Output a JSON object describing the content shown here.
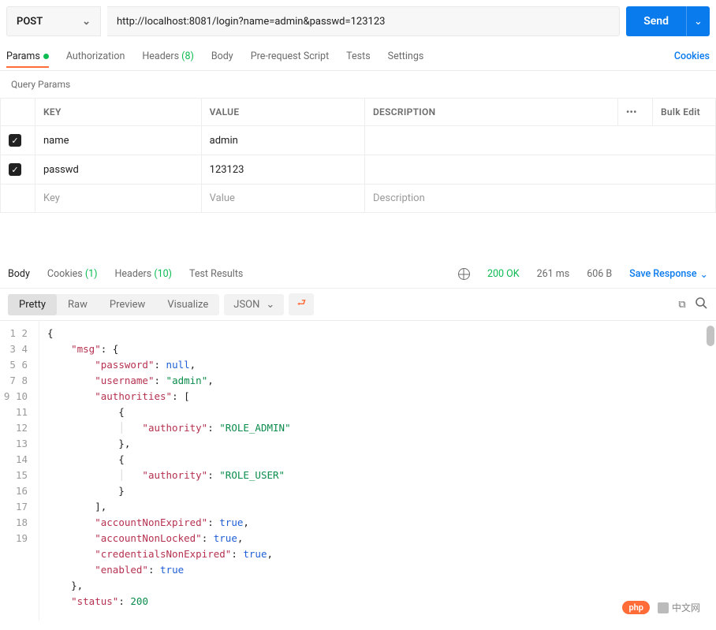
{
  "request": {
    "method": "POST",
    "url": "http://localhost:8081/login?name=admin&passwd=123123",
    "send_label": "Send"
  },
  "request_tabs": {
    "params": "Params",
    "authorization": "Authorization",
    "headers_prefix": "Headers ",
    "headers_count": "(8)",
    "body": "Body",
    "prerequest": "Pre-request Script",
    "tests": "Tests",
    "settings": "Settings",
    "cookies": "Cookies"
  },
  "query_params": {
    "title": "Query Params",
    "headers": {
      "key": "KEY",
      "value": "VALUE",
      "description": "DESCRIPTION"
    },
    "rows": [
      {
        "checked": true,
        "key": "name",
        "value": "admin",
        "description": ""
      },
      {
        "checked": true,
        "key": "passwd",
        "value": "123123",
        "description": ""
      }
    ],
    "placeholder_key": "Key",
    "placeholder_value": "Value",
    "placeholder_description": "Description",
    "bulk_edit": "Bulk Edit"
  },
  "response_tabs": {
    "body": "Body",
    "cookies_prefix": "Cookies ",
    "cookies_count": "(1)",
    "headers_prefix": "Headers ",
    "headers_count": "(10)",
    "test_results": "Test Results",
    "status": "200 OK",
    "time": "261 ms",
    "size": "606 B",
    "save_response": "Save Response"
  },
  "viewbar": {
    "pretty": "Pretty",
    "raw": "Raw",
    "preview": "Preview",
    "visualize": "Visualize",
    "format": "JSON"
  },
  "response_body": {
    "msg": {
      "password": null,
      "username": "admin",
      "authorities": [
        {
          "authority": "ROLE_ADMIN"
        },
        {
          "authority": "ROLE_USER"
        }
      ],
      "accountNonExpired": true,
      "accountNonLocked": true,
      "credentialsNonExpired": true,
      "enabled": true
    },
    "status": 200
  },
  "footer": {
    "php": "php",
    "cn": "中文网"
  }
}
